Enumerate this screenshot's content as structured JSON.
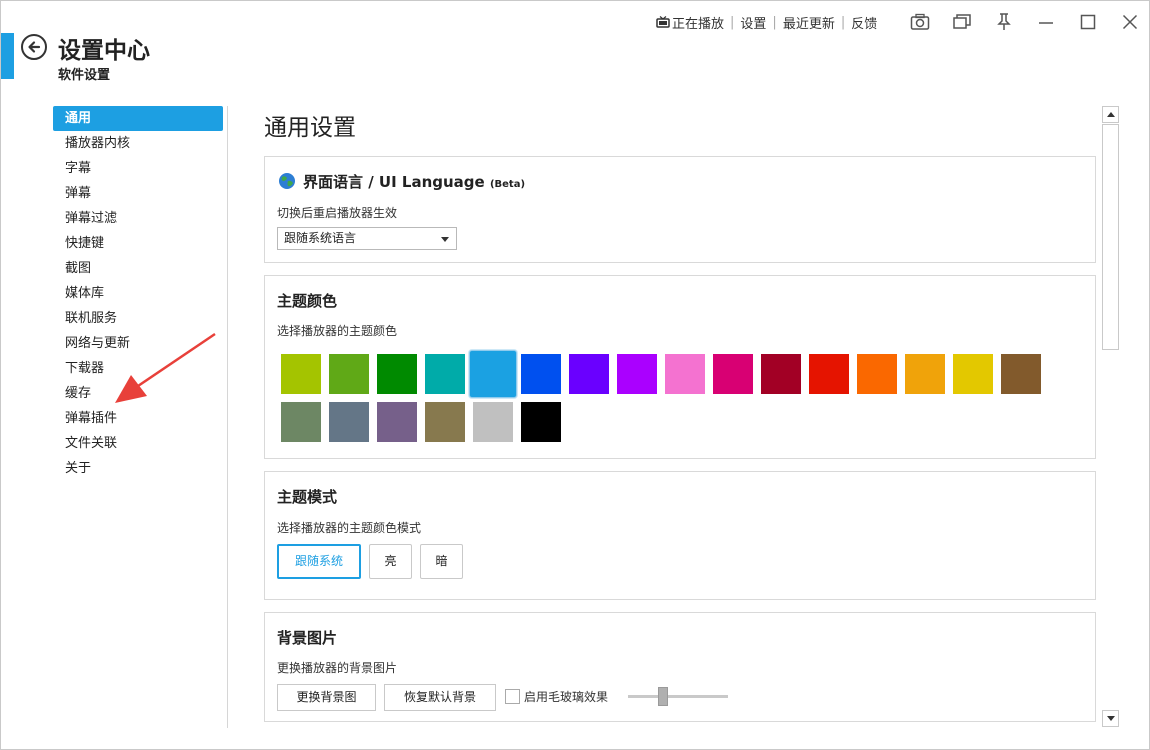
{
  "header": {
    "title": "设置中心",
    "subtitle": "软件设置"
  },
  "top_links": {
    "now_playing": "正在播放",
    "settings": "设置",
    "recent_updates": "最近更新",
    "feedback": "反馈"
  },
  "window_icons": [
    "camera-icon",
    "restore-window-icon",
    "pin-icon",
    "minimize-icon",
    "maximize-icon",
    "close-icon"
  ],
  "sidebar": {
    "items": [
      {
        "label": "通用",
        "active": true
      },
      {
        "label": "播放器内核"
      },
      {
        "label": "字幕"
      },
      {
        "label": "弹幕"
      },
      {
        "label": "弹幕过滤"
      },
      {
        "label": "快捷键"
      },
      {
        "label": "截图"
      },
      {
        "label": "媒体库"
      },
      {
        "label": "联机服务"
      },
      {
        "label": "网络与更新"
      },
      {
        "label": "下载器"
      },
      {
        "label": "缓存"
      },
      {
        "label": "弹幕插件"
      },
      {
        "label": "文件关联"
      },
      {
        "label": "关于"
      }
    ]
  },
  "main": {
    "title": "通用设置",
    "language": {
      "title": "界面语言 / UI Language",
      "beta": "(Beta)",
      "desc": "切换后重启播放器生效",
      "selected": "跟随系统语言"
    },
    "theme_color": {
      "title": "主题颜色",
      "desc": "选择播放器的主题颜色",
      "swatches": [
        "#a4c400",
        "#60a917",
        "#008a00",
        "#00aba9",
        "#1ba1e2",
        "#0050ef",
        "#6a00ff",
        "#aa00ff",
        "#f472d0",
        "#d80073",
        "#a20025",
        "#e51400",
        "#fa6800",
        "#f0a30a",
        "#e3c800",
        "#825a2c",
        "#6d8764",
        "#647687",
        "#76608a",
        "#87794e",
        "#c0c0c0",
        "#000000"
      ],
      "selected_index": 4
    },
    "theme_mode": {
      "title": "主题模式",
      "desc": "选择播放器的主题颜色模式",
      "options": [
        "跟随系统",
        "亮",
        "暗"
      ],
      "selected_index": 0
    },
    "background": {
      "title": "背景图片",
      "desc": "更换播放器的背景图片",
      "change_button": "更换背景图",
      "reset_button": "恢复默认背景",
      "blur_label": "启用毛玻璃效果",
      "blur_enabled": false,
      "blur_level": 0.35
    }
  },
  "colors": {
    "accent": "#1d9fe2"
  }
}
